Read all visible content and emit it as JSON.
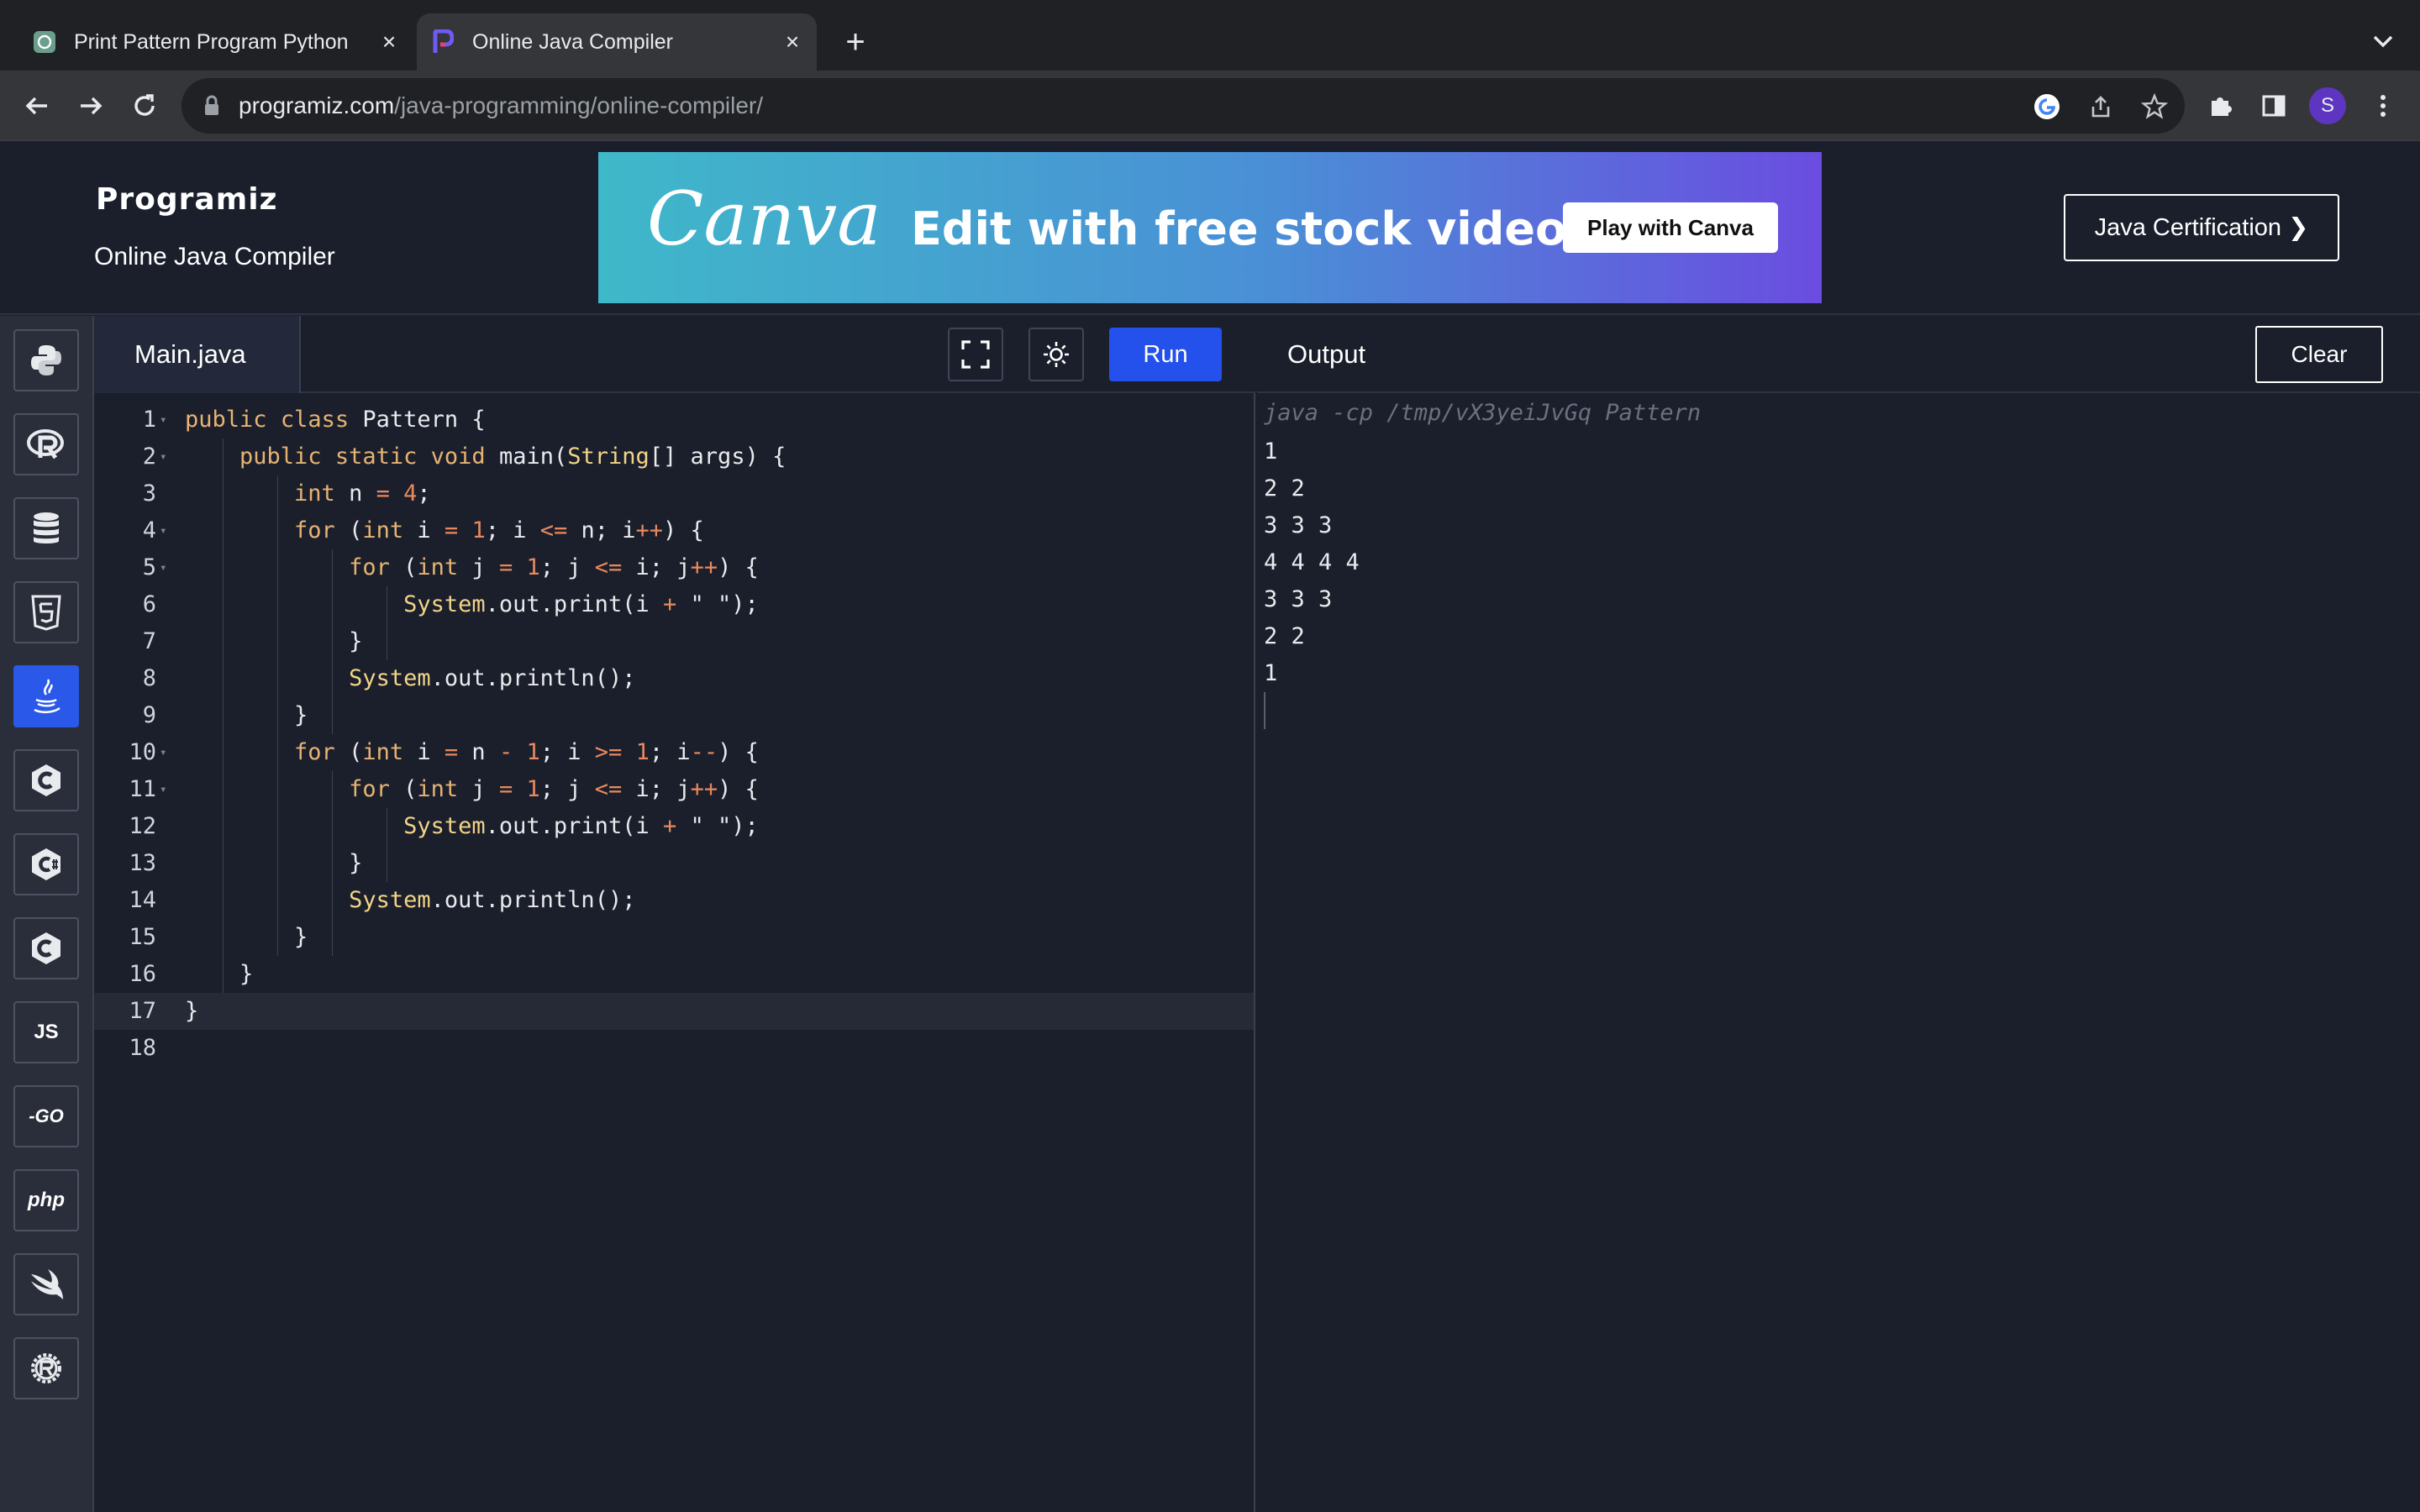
{
  "browser": {
    "tabs": [
      {
        "title": "Print Pattern Program Python",
        "active": false,
        "icon": "chatgpt-icon"
      },
      {
        "title": "Online Java Compiler",
        "active": true,
        "icon": "programiz-icon"
      }
    ],
    "url_host": "programiz.com",
    "url_path": "/java-programming/online-compiler/",
    "profile_initial": "S"
  },
  "header": {
    "logo": "Programiz",
    "subtitle": "Online Java Compiler",
    "ad": {
      "brand": "Canva",
      "tagline": "Edit with free stock videos",
      "button": "Play with Canva"
    },
    "cert_button": "Java Certification ❯"
  },
  "sidebar": {
    "languages": [
      {
        "name": "python-icon",
        "label": ""
      },
      {
        "name": "r-icon",
        "label": ""
      },
      {
        "name": "sql-icon",
        "label": ""
      },
      {
        "name": "html5-icon",
        "label": "5"
      },
      {
        "name": "java-icon",
        "label": "",
        "active": true
      },
      {
        "name": "c-icon",
        "label": "C"
      },
      {
        "name": "csharp-icon",
        "label": "C"
      },
      {
        "name": "cpp-icon",
        "label": "C"
      },
      {
        "name": "javascript-icon",
        "label": "JS"
      },
      {
        "name": "go-icon",
        "label": "-GO"
      },
      {
        "name": "php-icon",
        "label": "php"
      },
      {
        "name": "swift-icon",
        "label": ""
      },
      {
        "name": "rust-icon",
        "label": "R"
      }
    ]
  },
  "editor": {
    "filename": "Main.java",
    "run_label": "Run",
    "lines": [
      "public class Pattern {",
      "    public static void main(String[] args) {",
      "        int n = 4;",
      "        for (int i = 1; i <= n; i++) {",
      "            for (int j = 1; j <= i; j++) {",
      "                System.out.print(i + \" \");",
      "            }",
      "            System.out.println();",
      "        }",
      "        for (int i = n - 1; i >= 1; i--) {",
      "            for (int j = 1; j <= i; j++) {",
      "                System.out.print(i + \" \");",
      "            }",
      "            System.out.println();",
      "        }",
      "    }",
      "}",
      ""
    ],
    "line_numbers": [
      "1",
      "2",
      "3",
      "4",
      "5",
      "6",
      "7",
      "8",
      "9",
      "10",
      "11",
      "12",
      "13",
      "14",
      "15",
      "16",
      "17",
      "18"
    ]
  },
  "output": {
    "title": "Output",
    "clear_label": "Clear",
    "command": "java -cp /tmp/vX3yeiJvGq Pattern",
    "lines": [
      "1",
      "2 2",
      "3 3 3",
      "4 4 4 4",
      "3 3 3",
      "2 2",
      "1"
    ]
  },
  "colors": {
    "keyword": "#e7b373",
    "type": "#e7b373",
    "number": "#e8895d",
    "operator": "#e8895d",
    "classname": "#f2d488",
    "accent": "#2451ec"
  }
}
